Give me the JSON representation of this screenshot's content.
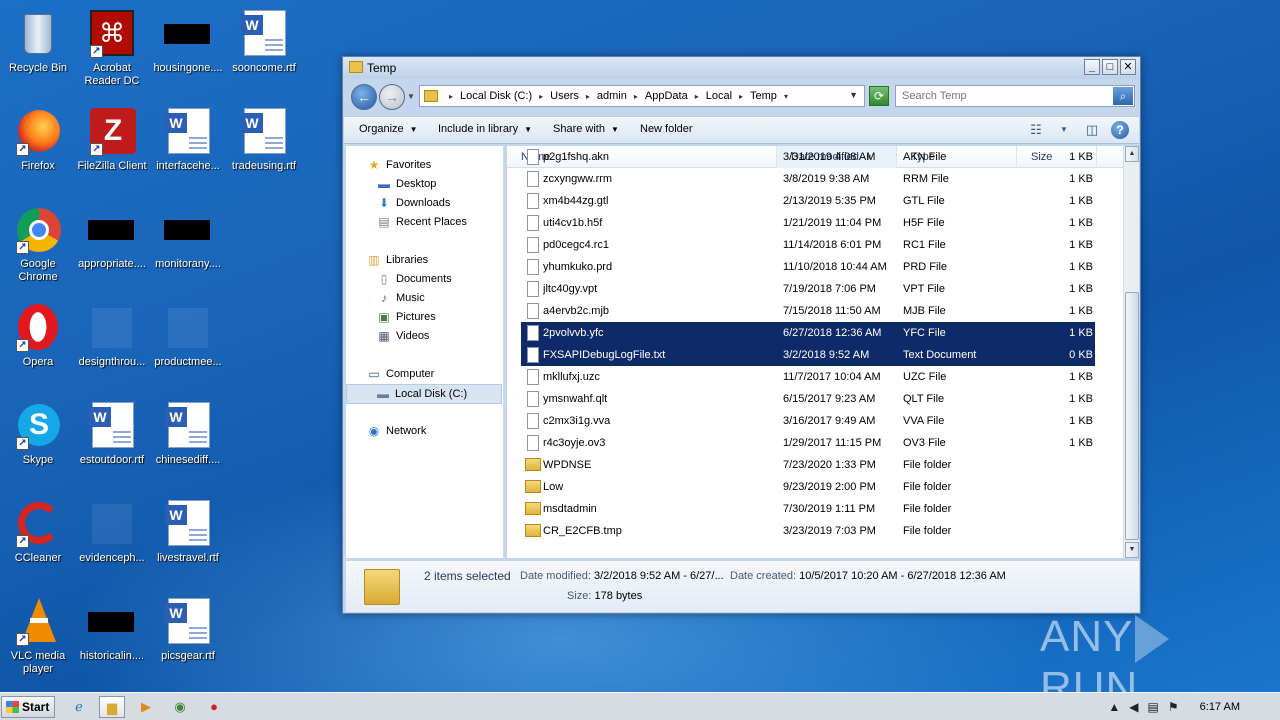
{
  "desktop": {
    "icons": [
      {
        "label": "Recycle Bin",
        "icon": "recycle-bin-icon"
      },
      {
        "label": "Acrobat Reader DC",
        "icon": "acrobat-icon"
      },
      {
        "label": "housingone....",
        "icon": "redacted-icon"
      },
      {
        "label": "sooncome.rtf",
        "icon": "word-doc-icon"
      },
      {
        "label": "Firefox",
        "icon": "firefox-icon"
      },
      {
        "label": "FileZilla Client",
        "icon": "filezilla-icon"
      },
      {
        "label": "interfacehe...",
        "icon": "word-doc-icon"
      },
      {
        "label": "tradeusing.rtf",
        "icon": "word-doc-icon"
      },
      {
        "label": "Google Chrome",
        "icon": "chrome-icon"
      },
      {
        "label": "appropriate....",
        "icon": "redacted-icon"
      },
      {
        "label": "monitorany....",
        "icon": "redacted-icon"
      },
      {
        "label": "Opera",
        "icon": "opera-icon"
      },
      {
        "label": "designthrou...",
        "icon": "blank-icon"
      },
      {
        "label": "productmee...",
        "icon": "blank-icon"
      },
      {
        "label": "Skype",
        "icon": "skype-icon"
      },
      {
        "label": "estoutdoor.rtf",
        "icon": "word-doc-icon"
      },
      {
        "label": "chinesediff....",
        "icon": "word-doc-icon"
      },
      {
        "label": "CCleaner",
        "icon": "ccleaner-icon"
      },
      {
        "label": "evidenceph...",
        "icon": "blank-icon"
      },
      {
        "label": "livestravel.rtf",
        "icon": "word-doc-icon"
      },
      {
        "label": "VLC media player",
        "icon": "vlc-icon"
      },
      {
        "label": "historicalin....",
        "icon": "redacted-icon"
      },
      {
        "label": "picsgear.rtf",
        "icon": "word-doc-icon"
      }
    ]
  },
  "window": {
    "title": "Temp",
    "address": {
      "crumbs": [
        "Local Disk (C:)",
        "Users",
        "admin",
        "AppData",
        "Local",
        "Temp"
      ]
    },
    "search_placeholder": "Search Temp",
    "toolbar": {
      "organize": "Organize",
      "include": "Include in library",
      "share": "Share with",
      "new_folder": "New folder"
    },
    "nav": {
      "favorites": "Favorites",
      "desktop": "Desktop",
      "downloads": "Downloads",
      "recent": "Recent Places",
      "libraries": "Libraries",
      "documents": "Documents",
      "music": "Music",
      "pictures": "Pictures",
      "videos": "Videos",
      "computer": "Computer",
      "local_disk": "Local Disk (C:)",
      "network": "Network"
    },
    "columns": {
      "name": "Name",
      "date": "Date modified",
      "type": "Type",
      "size": "Size"
    },
    "files": [
      {
        "name": "p2g1fshq.akn",
        "date": "3/31/2019 4:08 AM",
        "type": "AKN File",
        "size": "1 KB",
        "kind": "file",
        "selected": false
      },
      {
        "name": "zcxyngww.rrm",
        "date": "3/8/2019 9:38 AM",
        "type": "RRM File",
        "size": "1 KB",
        "kind": "file",
        "selected": false
      },
      {
        "name": "xm4b44zg.gtl",
        "date": "2/13/2019 5:35 PM",
        "type": "GTL File",
        "size": "1 KB",
        "kind": "file",
        "selected": false
      },
      {
        "name": "uti4cv1b.h5f",
        "date": "1/21/2019 11:04 PM",
        "type": "H5F File",
        "size": "1 KB",
        "kind": "file",
        "selected": false
      },
      {
        "name": "pd0cegc4.rc1",
        "date": "11/14/2018 6:01 PM",
        "type": "RC1 File",
        "size": "1 KB",
        "kind": "file",
        "selected": false
      },
      {
        "name": "yhumkuko.prd",
        "date": "11/10/2018 10:44 AM",
        "type": "PRD File",
        "size": "1 KB",
        "kind": "file",
        "selected": false
      },
      {
        "name": "jltc40gy.vpt",
        "date": "7/19/2018 7:06 PM",
        "type": "VPT File",
        "size": "1 KB",
        "kind": "file",
        "selected": false
      },
      {
        "name": "a4ervb2c.mjb",
        "date": "7/15/2018 11:50 AM",
        "type": "MJB File",
        "size": "1 KB",
        "kind": "file",
        "selected": false
      },
      {
        "name": "2pvolvvb.yfc",
        "date": "6/27/2018 12:36 AM",
        "type": "YFC File",
        "size": "1 KB",
        "kind": "file",
        "selected": true
      },
      {
        "name": "FXSAPIDebugLogFile.txt",
        "date": "3/2/2018 9:52 AM",
        "type": "Text Document",
        "size": "0 KB",
        "kind": "file",
        "selected": true
      },
      {
        "name": "mkllufxj.uzc",
        "date": "11/7/2017 10:04 AM",
        "type": "UZC File",
        "size": "1 KB",
        "kind": "file",
        "selected": false
      },
      {
        "name": "ymsnwahf.qlt",
        "date": "6/15/2017 9:23 AM",
        "type": "QLT File",
        "size": "1 KB",
        "kind": "file",
        "selected": false
      },
      {
        "name": "c2mx3i1g.vva",
        "date": "3/16/2017 9:49 AM",
        "type": "VVA File",
        "size": "1 KB",
        "kind": "file",
        "selected": false
      },
      {
        "name": "r4c3oyje.ov3",
        "date": "1/29/2017 11:15 PM",
        "type": "OV3 File",
        "size": "1 KB",
        "kind": "file",
        "selected": false
      },
      {
        "name": "WPDNSE",
        "date": "7/23/2020 1:33 PM",
        "type": "File folder",
        "size": "",
        "kind": "folder",
        "selected": false
      },
      {
        "name": "Low",
        "date": "9/23/2019 2:00 PM",
        "type": "File folder",
        "size": "",
        "kind": "folder",
        "selected": false
      },
      {
        "name": "msdtadmin",
        "date": "7/30/2019 1:11 PM",
        "type": "File folder",
        "size": "",
        "kind": "folder",
        "selected": false
      },
      {
        "name": "CR_E2CFB.tmp",
        "date": "3/23/2019 7:03 PM",
        "type": "File folder",
        "size": "",
        "kind": "folder",
        "selected": false
      }
    ],
    "details": {
      "summary": "2 items selected",
      "date_modified_label": "Date modified:",
      "date_modified_value": "3/2/2018 9:52 AM - 6/27/...",
      "date_created_label": "Date created:",
      "date_created_value": "10/5/2017 10:20 AM - 6/27/2018 12:36 AM",
      "size_label": "Size:",
      "size_value": "178 bytes"
    }
  },
  "taskbar": {
    "start_label": "Start",
    "clock": "6:17 AM"
  },
  "watermark": {
    "left": "ANY",
    "right": "RUN"
  }
}
